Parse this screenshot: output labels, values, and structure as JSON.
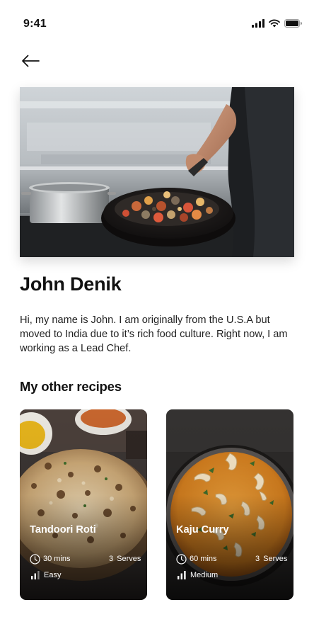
{
  "status_bar": {
    "time": "9:41"
  },
  "chef": {
    "name": "John Denik",
    "bio": "Hi, my name is John. I am originally from the U.S.A but moved to India due to it’s rich food culture. Right now, I am working as a Lead Chef."
  },
  "section": {
    "title": "My other recipes"
  },
  "recipes": [
    {
      "name": "Tandoori Roti",
      "time": "30 mins",
      "serves_count": "3",
      "serves_label": "Serves",
      "difficulty": "Easy"
    },
    {
      "name": "Kaju Curry",
      "time": "60 mins",
      "serves_count": "3",
      "serves_label": "Serves",
      "difficulty": "Medium"
    }
  ],
  "icons": {
    "back": "arrow-left-icon",
    "signal": "signal-icon",
    "wifi": "wifi-icon",
    "battery": "battery-icon",
    "clock": "clock-icon",
    "level": "bar-level-icon"
  },
  "colors": {
    "text": "#111111",
    "card_text": "#ffffff",
    "curry": "#d58a25",
    "pan": "#1f1c1b"
  }
}
